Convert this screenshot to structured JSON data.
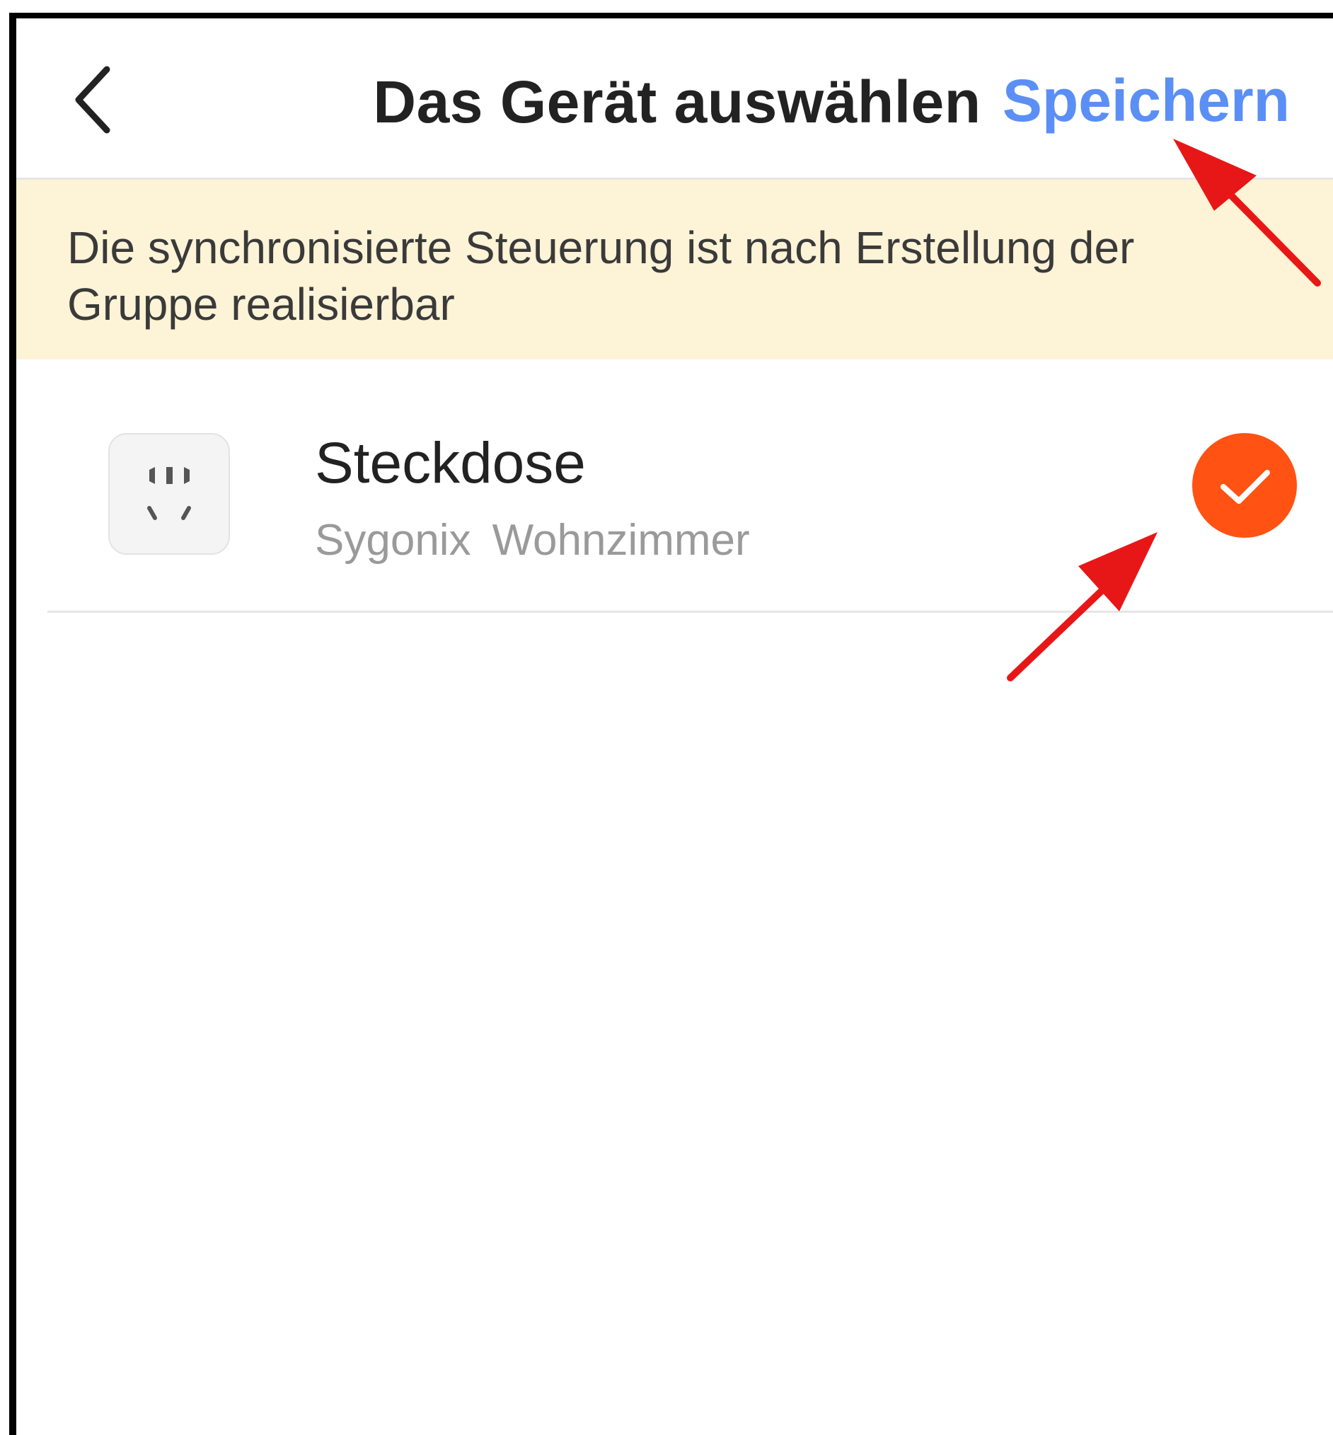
{
  "header": {
    "title": "Das Gerät auswählen",
    "save_label": "Speichern"
  },
  "banner": {
    "text": "Die synchronisierte Steuerung ist nach Erstellung der Gruppe realisierbar"
  },
  "devices": [
    {
      "name": "Steckdose",
      "brand": "Sygonix",
      "room": "Wohnzimmer",
      "icon": "power-socket-icon",
      "selected": true
    }
  ],
  "colors": {
    "accent_blue": "#5b8ff5",
    "check_orange": "#ff5213",
    "banner_bg": "#fdf3d6",
    "annotation_red": "#e81717"
  }
}
